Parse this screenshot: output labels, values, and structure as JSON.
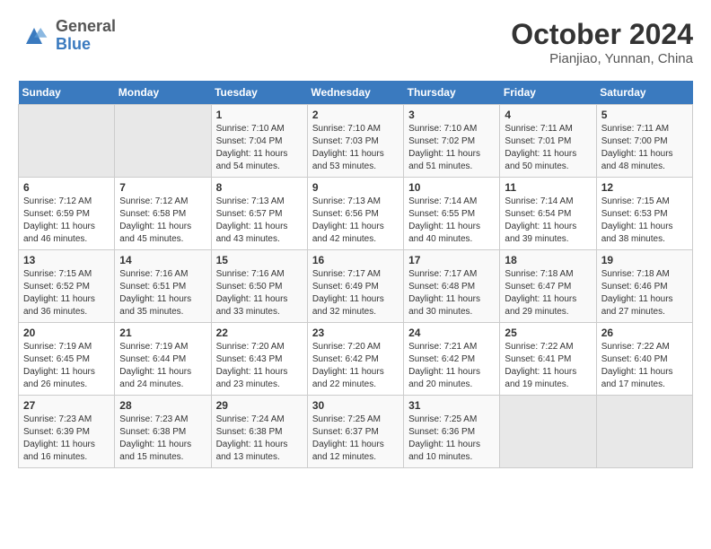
{
  "logo": {
    "line1": "General",
    "line2": "Blue"
  },
  "title": "October 2024",
  "subtitle": "Pianjiao, Yunnan, China",
  "days_header": [
    "Sunday",
    "Monday",
    "Tuesday",
    "Wednesday",
    "Thursday",
    "Friday",
    "Saturday"
  ],
  "weeks": [
    [
      {
        "day": "",
        "info": ""
      },
      {
        "day": "",
        "info": ""
      },
      {
        "day": "1",
        "info": "Sunrise: 7:10 AM\nSunset: 7:04 PM\nDaylight: 11 hours and 54 minutes."
      },
      {
        "day": "2",
        "info": "Sunrise: 7:10 AM\nSunset: 7:03 PM\nDaylight: 11 hours and 53 minutes."
      },
      {
        "day": "3",
        "info": "Sunrise: 7:10 AM\nSunset: 7:02 PM\nDaylight: 11 hours and 51 minutes."
      },
      {
        "day": "4",
        "info": "Sunrise: 7:11 AM\nSunset: 7:01 PM\nDaylight: 11 hours and 50 minutes."
      },
      {
        "day": "5",
        "info": "Sunrise: 7:11 AM\nSunset: 7:00 PM\nDaylight: 11 hours and 48 minutes."
      }
    ],
    [
      {
        "day": "6",
        "info": "Sunrise: 7:12 AM\nSunset: 6:59 PM\nDaylight: 11 hours and 46 minutes."
      },
      {
        "day": "7",
        "info": "Sunrise: 7:12 AM\nSunset: 6:58 PM\nDaylight: 11 hours and 45 minutes."
      },
      {
        "day": "8",
        "info": "Sunrise: 7:13 AM\nSunset: 6:57 PM\nDaylight: 11 hours and 43 minutes."
      },
      {
        "day": "9",
        "info": "Sunrise: 7:13 AM\nSunset: 6:56 PM\nDaylight: 11 hours and 42 minutes."
      },
      {
        "day": "10",
        "info": "Sunrise: 7:14 AM\nSunset: 6:55 PM\nDaylight: 11 hours and 40 minutes."
      },
      {
        "day": "11",
        "info": "Sunrise: 7:14 AM\nSunset: 6:54 PM\nDaylight: 11 hours and 39 minutes."
      },
      {
        "day": "12",
        "info": "Sunrise: 7:15 AM\nSunset: 6:53 PM\nDaylight: 11 hours and 38 minutes."
      }
    ],
    [
      {
        "day": "13",
        "info": "Sunrise: 7:15 AM\nSunset: 6:52 PM\nDaylight: 11 hours and 36 minutes."
      },
      {
        "day": "14",
        "info": "Sunrise: 7:16 AM\nSunset: 6:51 PM\nDaylight: 11 hours and 35 minutes."
      },
      {
        "day": "15",
        "info": "Sunrise: 7:16 AM\nSunset: 6:50 PM\nDaylight: 11 hours and 33 minutes."
      },
      {
        "day": "16",
        "info": "Sunrise: 7:17 AM\nSunset: 6:49 PM\nDaylight: 11 hours and 32 minutes."
      },
      {
        "day": "17",
        "info": "Sunrise: 7:17 AM\nSunset: 6:48 PM\nDaylight: 11 hours and 30 minutes."
      },
      {
        "day": "18",
        "info": "Sunrise: 7:18 AM\nSunset: 6:47 PM\nDaylight: 11 hours and 29 minutes."
      },
      {
        "day": "19",
        "info": "Sunrise: 7:18 AM\nSunset: 6:46 PM\nDaylight: 11 hours and 27 minutes."
      }
    ],
    [
      {
        "day": "20",
        "info": "Sunrise: 7:19 AM\nSunset: 6:45 PM\nDaylight: 11 hours and 26 minutes."
      },
      {
        "day": "21",
        "info": "Sunrise: 7:19 AM\nSunset: 6:44 PM\nDaylight: 11 hours and 24 minutes."
      },
      {
        "day": "22",
        "info": "Sunrise: 7:20 AM\nSunset: 6:43 PM\nDaylight: 11 hours and 23 minutes."
      },
      {
        "day": "23",
        "info": "Sunrise: 7:20 AM\nSunset: 6:42 PM\nDaylight: 11 hours and 22 minutes."
      },
      {
        "day": "24",
        "info": "Sunrise: 7:21 AM\nSunset: 6:42 PM\nDaylight: 11 hours and 20 minutes."
      },
      {
        "day": "25",
        "info": "Sunrise: 7:22 AM\nSunset: 6:41 PM\nDaylight: 11 hours and 19 minutes."
      },
      {
        "day": "26",
        "info": "Sunrise: 7:22 AM\nSunset: 6:40 PM\nDaylight: 11 hours and 17 minutes."
      }
    ],
    [
      {
        "day": "27",
        "info": "Sunrise: 7:23 AM\nSunset: 6:39 PM\nDaylight: 11 hours and 16 minutes."
      },
      {
        "day": "28",
        "info": "Sunrise: 7:23 AM\nSunset: 6:38 PM\nDaylight: 11 hours and 15 minutes."
      },
      {
        "day": "29",
        "info": "Sunrise: 7:24 AM\nSunset: 6:38 PM\nDaylight: 11 hours and 13 minutes."
      },
      {
        "day": "30",
        "info": "Sunrise: 7:25 AM\nSunset: 6:37 PM\nDaylight: 11 hours and 12 minutes."
      },
      {
        "day": "31",
        "info": "Sunrise: 7:25 AM\nSunset: 6:36 PM\nDaylight: 11 hours and 10 minutes."
      },
      {
        "day": "",
        "info": ""
      },
      {
        "day": "",
        "info": ""
      }
    ]
  ]
}
